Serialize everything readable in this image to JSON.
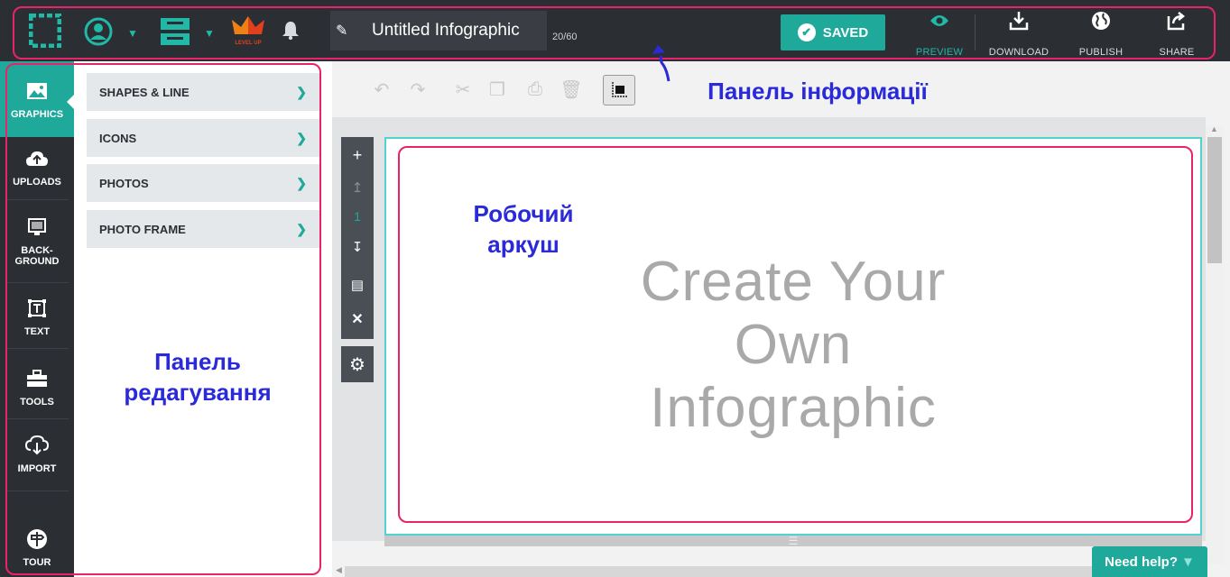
{
  "topbar": {
    "title": "Untitled Infographic",
    "char_count": "20/60",
    "level_up_label": "LEVEL UP",
    "saved_label": "SAVED",
    "actions": [
      {
        "label": "PREVIEW",
        "icon": "eye-icon"
      },
      {
        "label": "DOWNLOAD",
        "icon": "download-icon"
      },
      {
        "label": "PUBLISH",
        "icon": "globe-icon"
      },
      {
        "label": "SHARE",
        "icon": "share-icon"
      }
    ]
  },
  "rail": {
    "items": [
      {
        "label": "GRAPHICS",
        "icon": "image-icon"
      },
      {
        "label": "UPLOADS",
        "icon": "cloud-upload-icon"
      },
      {
        "label": "BACK-\nGROUND",
        "icon": "background-icon"
      },
      {
        "label": "TEXT",
        "icon": "text-box-icon"
      },
      {
        "label": "TOOLS",
        "icon": "toolbox-icon"
      },
      {
        "label": "IMPORT",
        "icon": "cloud-import-icon"
      },
      {
        "label": "TOUR",
        "icon": "signpost-icon"
      }
    ]
  },
  "categories": [
    {
      "label": "SHAPES & LINE"
    },
    {
      "label": "ICONS"
    },
    {
      "label": "PHOTOS"
    },
    {
      "label": "PHOTO FRAME"
    }
  ],
  "canvas": {
    "page_number": "1",
    "placeholder_lines": [
      "Create Your",
      "Own",
      "Infographic"
    ]
  },
  "help": {
    "label": "Need help?"
  },
  "annotations": {
    "info_panel": "Панель інформації",
    "worksheet": "Робочий\nаркуш",
    "edit_panel": "Панель\nредагування"
  },
  "colors": {
    "accent": "#1fa99b",
    "dark": "#2b2e33",
    "annotation_border": "#e8226b",
    "annotation_text": "#2a2ad8"
  }
}
